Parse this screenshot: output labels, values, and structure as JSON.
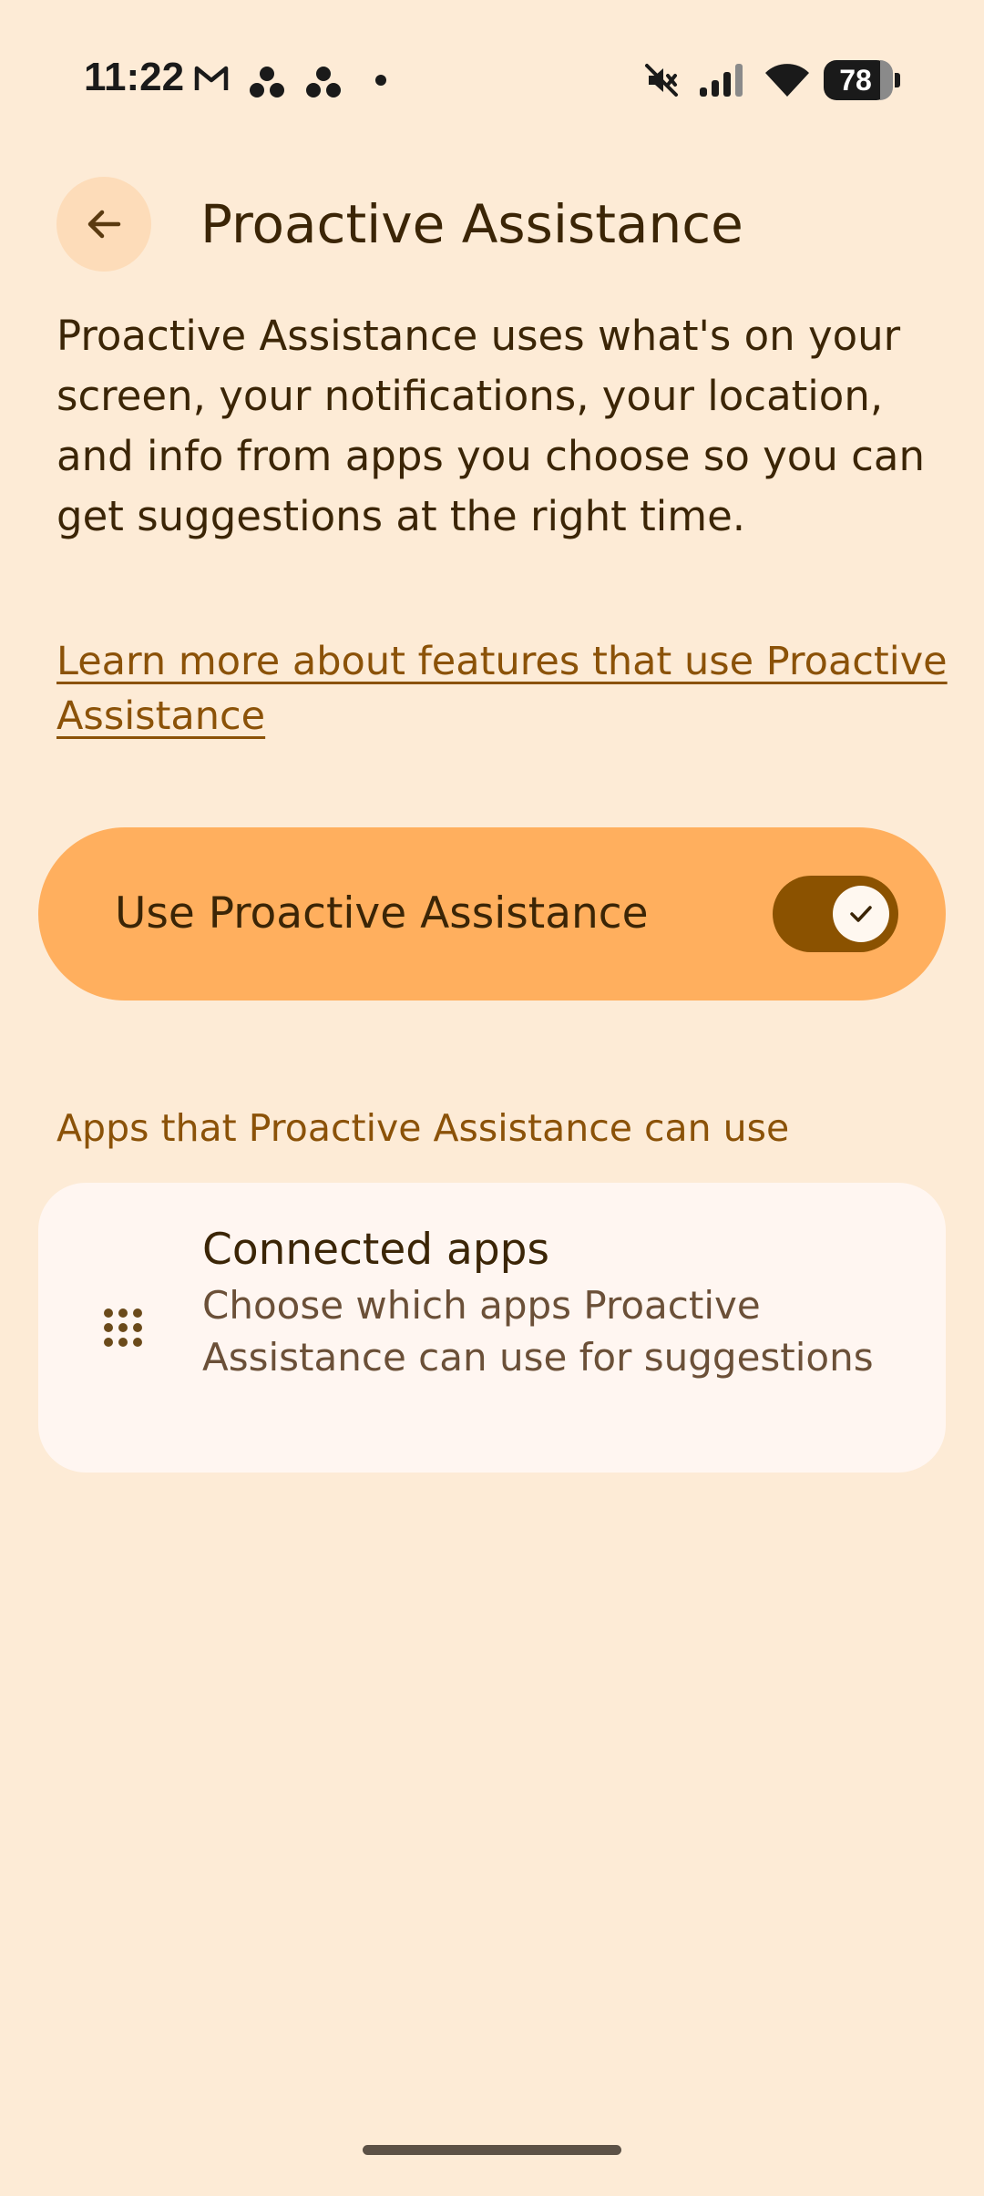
{
  "status_bar": {
    "time": "11:22",
    "battery": "78",
    "icons": [
      "gmail-icon",
      "dots-cluster-icon",
      "dots-cluster-icon",
      "dot-icon",
      "mute-icon",
      "signal-icon",
      "wifi-icon",
      "battery-icon"
    ]
  },
  "header": {
    "title": "Proactive Assistance",
    "back_icon": "arrow-back-icon"
  },
  "description": "Proactive Assistance uses what's on your screen, your notifications, your location, and info from apps you choose so you can get suggestions at the right time.",
  "learn_more_link": "Learn more about features that use Proactive Assistance",
  "toggle": {
    "label": "Use Proactive Assistance",
    "enabled": true
  },
  "section": {
    "header": "Apps that Proactive Assistance can use"
  },
  "connected_apps": {
    "title": "Connected apps",
    "subtitle": "Choose which apps Proactive Assistance can use for suggestions",
    "icon": "apps-grid-icon"
  },
  "colors": {
    "background": "#fdebd6",
    "accent": "#ffaf5e",
    "switch_track": "#8b5200",
    "link": "#8b5208",
    "text": "#3b2506"
  }
}
